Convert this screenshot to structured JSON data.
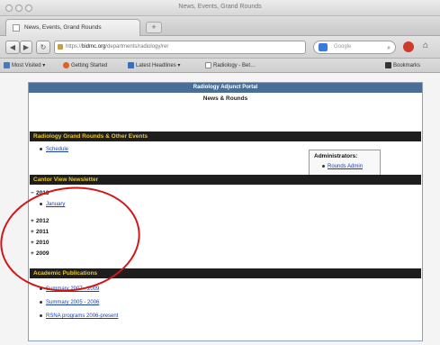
{
  "window": {
    "title": "News, Events, Grand Rounds"
  },
  "tab": {
    "label": "News, Events, Grand Rounds",
    "new_tab": "+"
  },
  "nav": {
    "back": "◀",
    "forward": "▶",
    "reload": "↻",
    "url_prefix": "https://",
    "url_domain": "bidmc.org",
    "url_rest": "/departments/radiology/rer",
    "search_placeholder": "Google",
    "bookmarks_button": "Bookmarks"
  },
  "bookmarks": [
    {
      "label": "Most Visited ▾",
      "color": "#4a7ab8"
    },
    {
      "label": "Getting Started",
      "color": "#e06020"
    },
    {
      "label": "Latest Headlines ▾",
      "color": "#3a6ec0"
    },
    {
      "label": "Radiology - Bet…",
      "color": "#888888"
    }
  ],
  "portal": {
    "header": "Radiology Adjunct Portal",
    "subtitle": "News & Rounds"
  },
  "sections": {
    "grand_rounds": {
      "title": "Radiology Grand Rounds & Other Events",
      "links": [
        "Schedule"
      ]
    },
    "newsletter": {
      "title": "Cantor View Newsletter",
      "expanded_year": "2013",
      "expanded_links": [
        "January"
      ],
      "collapsed_years": [
        "2012",
        "2011",
        "2010",
        "2009"
      ]
    },
    "publications": {
      "title": "Academic Publications",
      "links": [
        "Summary 2007 - 2009",
        "Summary 2005 - 2006",
        "RSNA programs 2006-present"
      ]
    }
  },
  "admin": {
    "title": "Administrators:",
    "link": "Rounds Admin"
  },
  "colors": {
    "portal_header": "#4a6e96",
    "section_bar": "#1e1e1e",
    "section_text": "#e8c830",
    "link": "#1a3fb0",
    "annotation_circle": "#d01818"
  }
}
